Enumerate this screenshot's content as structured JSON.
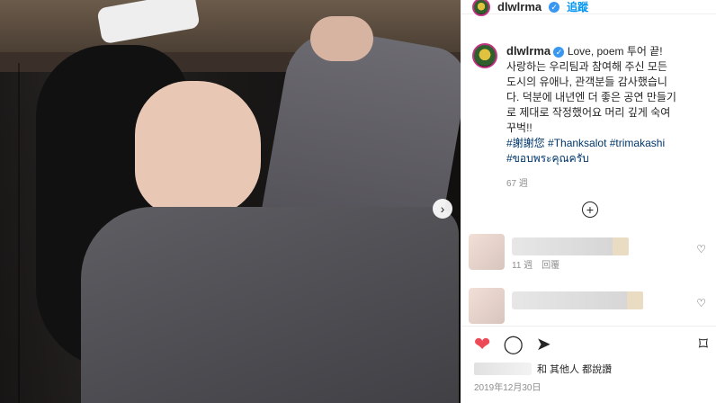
{
  "post": {
    "username": "dlwlrma",
    "follow_label": "追蹤",
    "caption_lines": [
      "Love, poem 투어 끝!",
      "사랑하는 우리팀과 참여해 주신 모든",
      "도시의 유애나, 관객분들 감사했습니",
      "다. 덕분에 내년엔 더 좋은 공연 만들기",
      "로 제대로 작정했어요 머리 깊게 숙여",
      "꾸벅!!"
    ],
    "hashtags": [
      "#謝謝您",
      "#Thanksalot",
      "#trimakashi",
      "#ขอบพระคุณครับ"
    ],
    "caption_time": "67 週",
    "comments": [
      {
        "time": "11 週",
        "reply_label": "回覆"
      },
      {
        "time": "",
        "reply_label": ""
      }
    ],
    "liked_by_suffix": "和 其他人 都說讚",
    "date": "2019年12月30日"
  },
  "icons": {
    "verified": "verified-badge-icon",
    "next": "chevron-right-icon",
    "plus": "plus-circle-icon",
    "heart": "heart-icon",
    "comment": "comment-icon",
    "share": "share-icon",
    "bookmark": "bookmark-icon"
  },
  "colors": {
    "accent": "#0095f6",
    "like": "#ed4956",
    "hashtag": "#00376b",
    "meta": "#8e8e8e"
  }
}
